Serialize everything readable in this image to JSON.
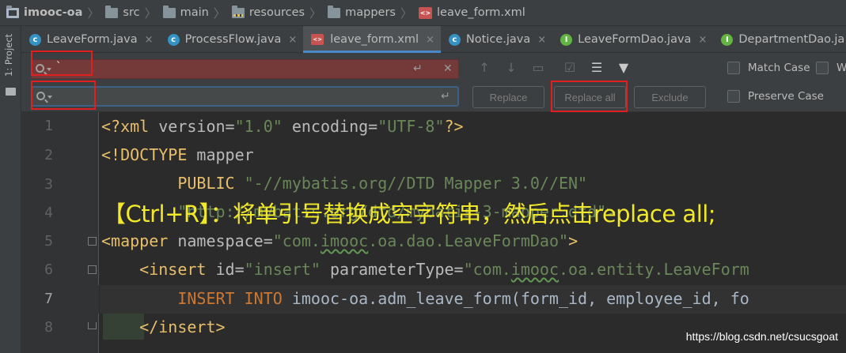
{
  "breadcrumb": {
    "items": [
      "imooc-oa",
      "src",
      "main",
      "resources",
      "mappers",
      "leave_form.xml"
    ]
  },
  "side_panel": {
    "label": "1: Project"
  },
  "tabs": [
    {
      "label": "LeaveForm.java",
      "icon": "C",
      "active": false
    },
    {
      "label": "ProcessFlow.java",
      "icon": "C",
      "active": false
    },
    {
      "label": "leave_form.xml",
      "icon": "xml",
      "active": true
    },
    {
      "label": "Notice.java",
      "icon": "C",
      "active": false
    },
    {
      "label": "LeaveFormDao.java",
      "icon": "I",
      "active": false
    },
    {
      "label": "DepartmentDao.ja",
      "icon": "I",
      "active": false
    }
  ],
  "tab_close_glyph": "×",
  "find": {
    "search_value": "`",
    "replace_value": "",
    "buttons": {
      "replace": "Replace",
      "replace_all": "Replace all",
      "exclude": "Exclude"
    },
    "options": {
      "match_case": "Match Case",
      "whole_words": "W",
      "preserve_case": "Preserve Case"
    },
    "nav_glyphs": {
      "prev": "↑",
      "next": "↓",
      "select_all": "▭",
      "multi": "☑",
      "filter_lines": "☰",
      "filter": "▼"
    },
    "field_glyphs": {
      "newline": "↵",
      "clear": "✕"
    }
  },
  "editor": {
    "line_numbers": [
      "1",
      "2",
      "3",
      "4",
      "5",
      "6",
      "7",
      "8"
    ],
    "lines": [
      {
        "segments": [
          {
            "t": "<?xml ",
            "c": "tag"
          },
          {
            "t": "version=",
            "c": "attr"
          },
          {
            "t": "\"1.0\"",
            "c": "val"
          },
          {
            "t": " encoding=",
            "c": "attr"
          },
          {
            "t": "\"UTF-8\"",
            "c": "val"
          },
          {
            "t": "?>",
            "c": "tag"
          }
        ]
      },
      {
        "segments": [
          {
            "t": "<!DOCTYPE ",
            "c": "tag"
          },
          {
            "t": "mapper",
            "c": "attr"
          }
        ]
      },
      {
        "segments": [
          {
            "t": "        PUBLIC ",
            "c": "tag"
          },
          {
            "t": "\"-//mybatis.org//DTD Mapper 3.0//EN\"",
            "c": "val"
          }
        ]
      },
      {
        "segments": [
          {
            "t": "        \"http://mybatis.org/dtd/mybatis-3-mapper.dtd\">",
            "c": "val"
          }
        ]
      },
      {
        "segments": [
          {
            "t": "<mapper ",
            "c": "tag"
          },
          {
            "t": "namespace=",
            "c": "attr"
          },
          {
            "t": "\"com.",
            "c": "val"
          },
          {
            "t": "imooc",
            "c": "val squig"
          },
          {
            "t": ".oa.dao.LeaveFormDao\"",
            "c": "val"
          },
          {
            "t": ">",
            "c": "tag"
          }
        ]
      },
      {
        "segments": [
          {
            "t": "    <insert ",
            "c": "tag"
          },
          {
            "t": "id=",
            "c": "attr"
          },
          {
            "t": "\"insert\"",
            "c": "val"
          },
          {
            "t": " parameterType=",
            "c": "attr"
          },
          {
            "t": "\"com.",
            "c": "val"
          },
          {
            "t": "imooc",
            "c": "val squig"
          },
          {
            "t": ".oa.entity.LeaveForm",
            "c": "val"
          }
        ]
      },
      {
        "segments": [
          {
            "t": "        INSERT INTO ",
            "c": "kw"
          },
          {
            "t": "imooc-oa.adm_leave_form(form_id, employee_id, fo",
            "c": "plain"
          }
        ]
      },
      {
        "segments": [
          {
            "t": "    </insert>",
            "c": "tag"
          }
        ]
      }
    ]
  },
  "overlay_caption": "【Ctrl+R】：将单引号替换成空字符串，然后点击replace all;",
  "watermark": "https://blog.csdn.net/csucsgoat"
}
